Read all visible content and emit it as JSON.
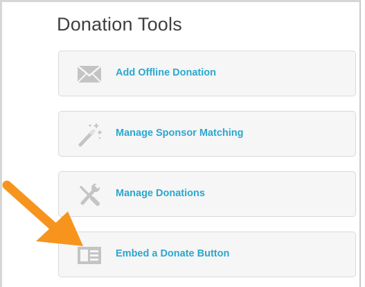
{
  "panel": {
    "title": "Donation Tools"
  },
  "tools": [
    {
      "label": "Add Offline Donation",
      "icon": "envelope-icon"
    },
    {
      "label": "Manage Sponsor Matching",
      "icon": "magic-wand-icon"
    },
    {
      "label": "Manage Donations",
      "icon": "wrench-screwdriver-icon"
    },
    {
      "label": "Embed a Donate Button",
      "icon": "embed-block-icon"
    }
  ],
  "annotation": {
    "icon": "orange-arrow-icon",
    "color": "#f7941d"
  },
  "colors": {
    "accent": "#2aa7cf",
    "icon_gray": "#c4c4c4",
    "title": "#3f3f3f"
  }
}
